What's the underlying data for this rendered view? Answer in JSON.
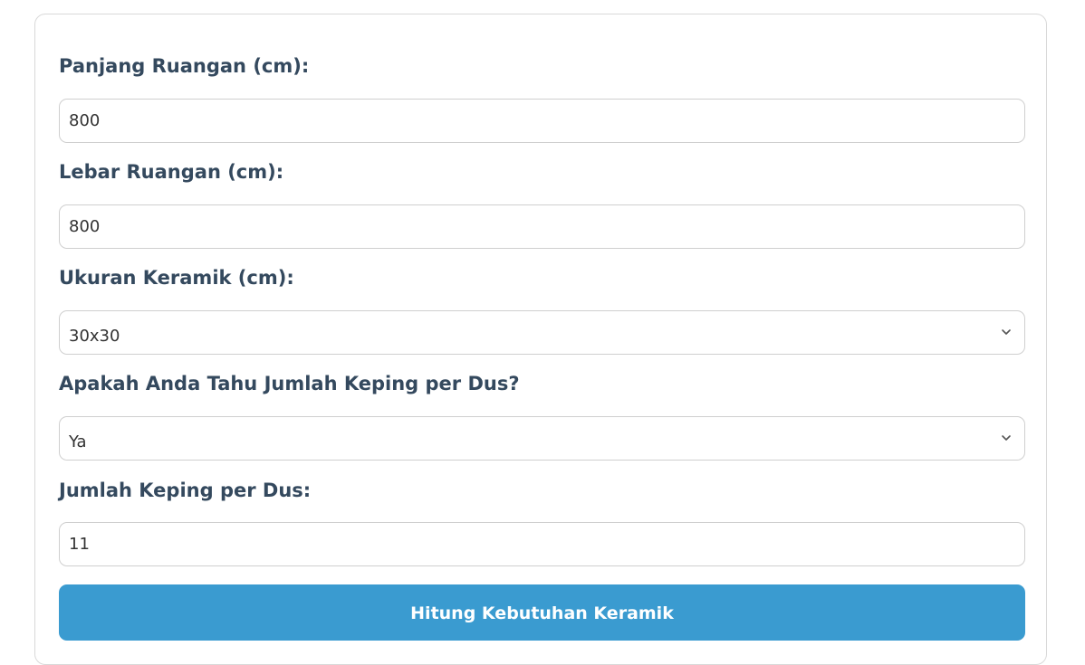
{
  "form": {
    "length_label": "Panjang Ruangan (cm):",
    "length_value": "800",
    "width_label": "Lebar Ruangan (cm):",
    "width_value": "800",
    "tile_size_label": "Ukuran Keramik (cm):",
    "tile_size_value": "30x30",
    "know_pieces_label": "Apakah Anda Tahu Jumlah Keping per Dus?",
    "know_pieces_value": "Ya",
    "pieces_label": "Jumlah Keping per Dus:",
    "pieces_value": "11",
    "submit_label": "Hitung Kebutuhan Keramik"
  },
  "icons": {
    "select_arrow": "chevron-down-icon"
  },
  "colors": {
    "label_text": "#34495e",
    "button_bg": "#3a9bd0",
    "button_text": "#ffffff",
    "border": "#cfcfcf"
  }
}
